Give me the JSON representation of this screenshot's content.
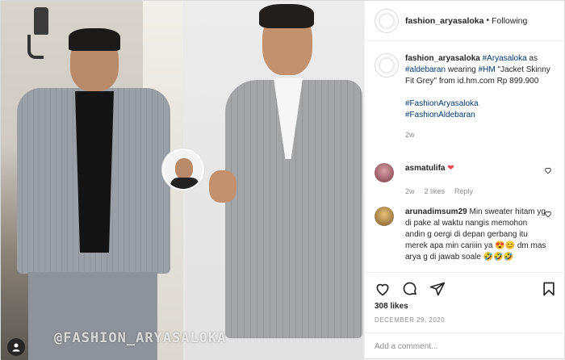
{
  "media": {
    "watermark": "@FASHION_ARYASALOKA"
  },
  "header": {
    "username": "fashion_aryasaloka",
    "separator": "•",
    "follow_status": "Following"
  },
  "caption": {
    "username": "fashion_aryasaloka",
    "parts": [
      {
        "text": "#Aryasaloka",
        "link": true
      },
      {
        "text": " as ",
        "link": false
      },
      {
        "text": "#aldebaran",
        "link": true
      },
      {
        "text": " wearing ",
        "link": false
      },
      {
        "text": "#HM",
        "link": true
      },
      {
        "text": " \"Jacket Skinny Fit Grey\" from id.hm.com Rp 899.900",
        "link": false
      }
    ],
    "tags": [
      "#FashionAryasaloka",
      "#FashionAldebaran"
    ],
    "age": "2w"
  },
  "comments": [
    {
      "username": "asmatulifa",
      "text": "❤",
      "age": "2w",
      "likes": "2 likes",
      "reply": "Reply"
    },
    {
      "username": "arunadimsum29",
      "text": "Min sweater hitam yg di pake al waktu nangis memohon andin g oergi di depan gerbang itu merek apa min cariiin ya 😍😊 dm mas arya g di jawab soale 🤣🤣🤣"
    }
  ],
  "actions": {
    "likes": "308 likes",
    "date": "DECEMBER 29, 2020"
  },
  "add_comment": {
    "placeholder": "Add a comment..."
  },
  "colors": {
    "link": "#00376b",
    "secondary": "#8e8e8e",
    "heart": "#ed4956"
  }
}
